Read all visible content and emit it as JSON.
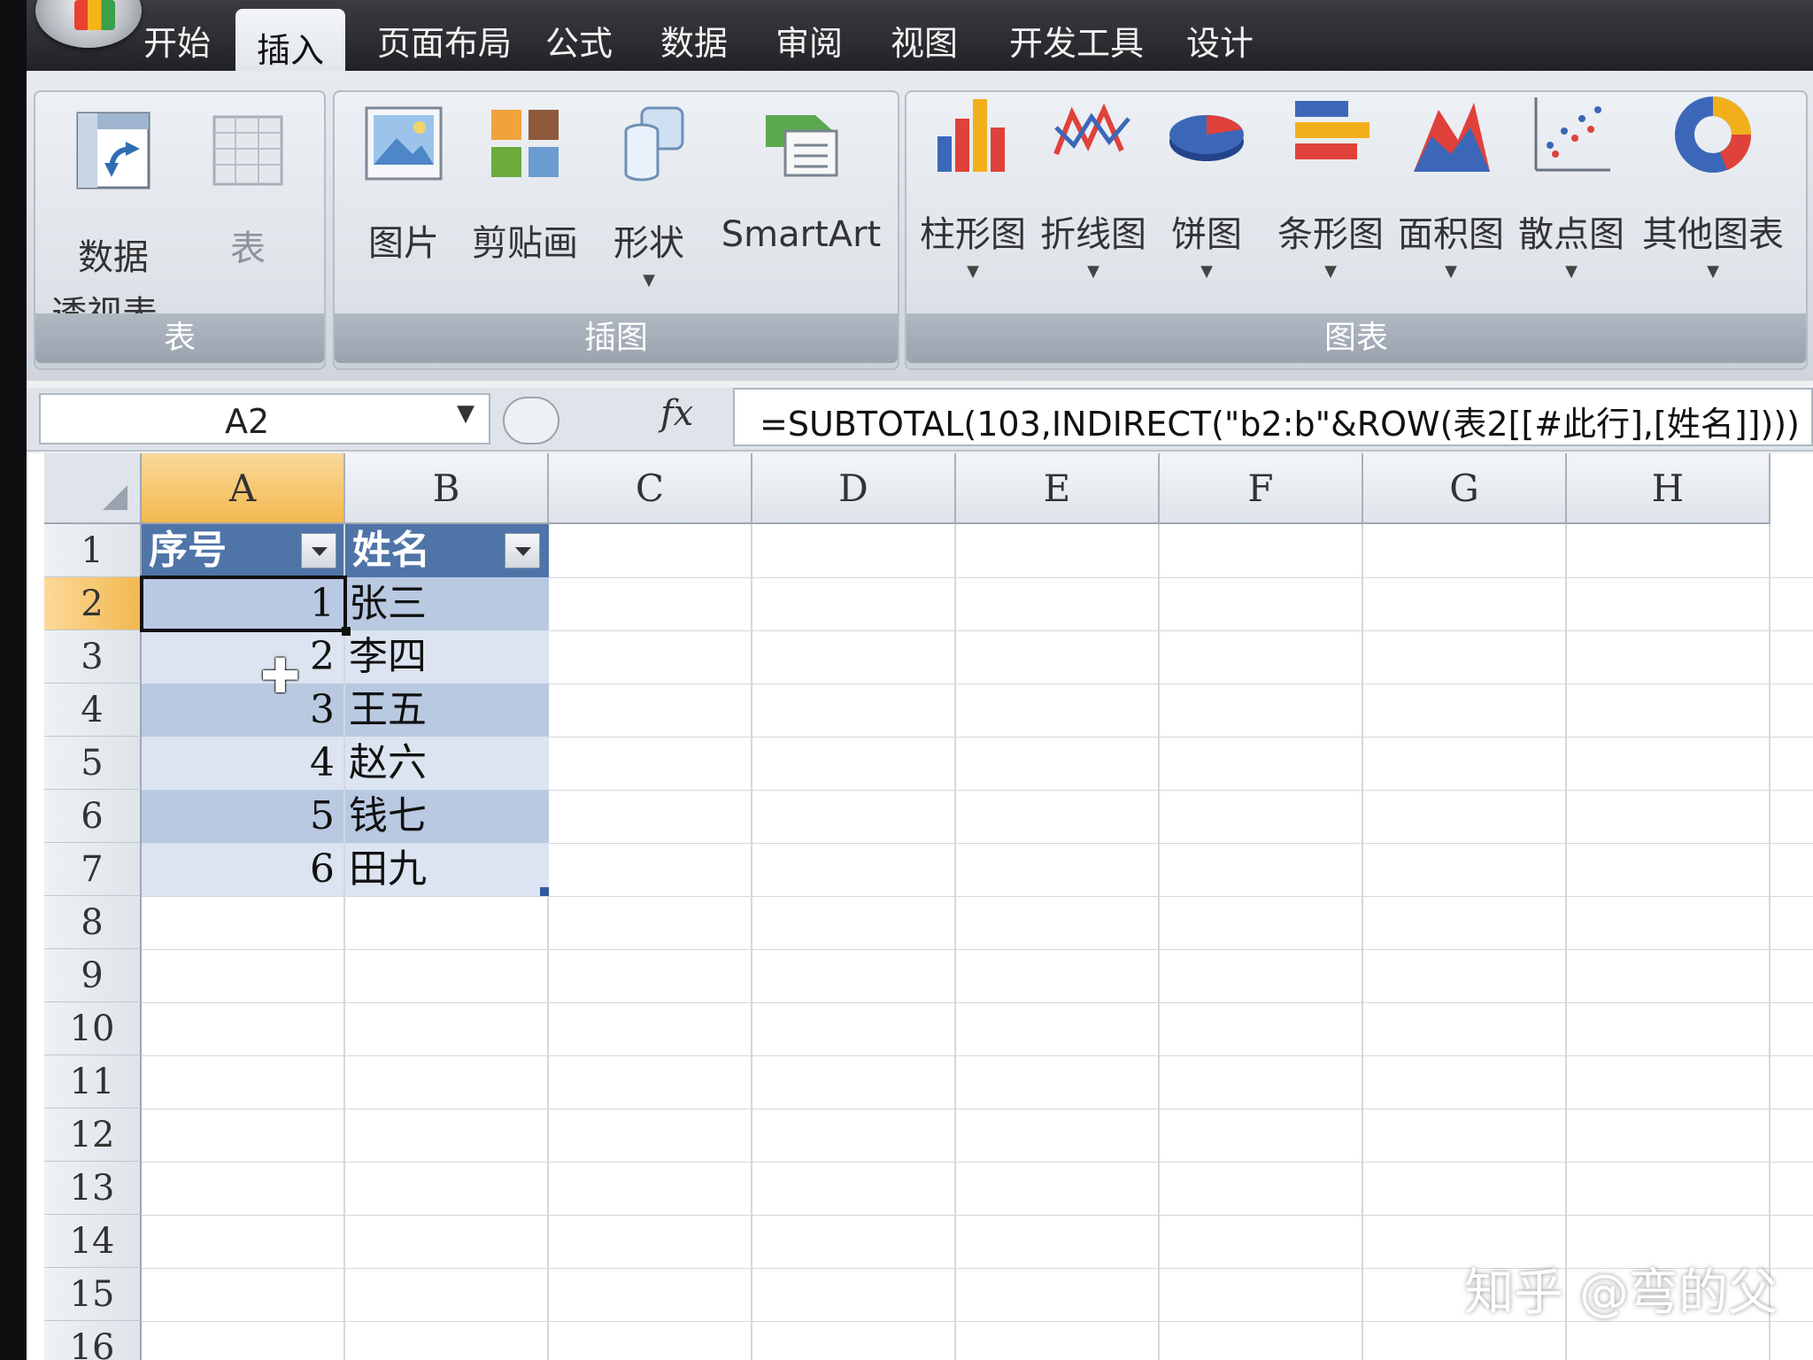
{
  "tabs": [
    "开始",
    "插入",
    "页面布局",
    "公式",
    "数据",
    "审阅",
    "视图",
    "开发工具",
    "设计"
  ],
  "active_tab": "插入",
  "ribbon": {
    "groups": {
      "table": {
        "label": "表",
        "pivot_line1": "数据",
        "pivot_line2": "透视表",
        "table_btn": "表"
      },
      "illustrations": {
        "label": "插图",
        "picture": "图片",
        "clipart": "剪贴画",
        "shapes": "形状",
        "smartart": "SmartArt"
      },
      "charts": {
        "label": "图表",
        "column": "柱形图",
        "line": "折线图",
        "pie": "饼图",
        "bar": "条形图",
        "area": "面积图",
        "scatter": "散点图",
        "other": "其他图表"
      }
    }
  },
  "formula_bar": {
    "name_box": "A2",
    "fx_label": "fx",
    "formula": "=SUBTOTAL(103,INDIRECT(\"b2:b\"&ROW(表2[[#此行],[姓名]])))"
  },
  "sheet": {
    "columns": [
      "A",
      "B",
      "C",
      "D",
      "E",
      "F",
      "G",
      "H"
    ],
    "rows": [
      "1",
      "2",
      "3",
      "4",
      "5",
      "6",
      "7",
      "8",
      "9",
      "10",
      "11",
      "12",
      "13",
      "14",
      "15",
      "16"
    ],
    "table_headers": {
      "a": "序号",
      "b": "姓名"
    },
    "table_rows": [
      {
        "num": "1",
        "name": "张三"
      },
      {
        "num": "2",
        "name": "李四"
      },
      {
        "num": "3",
        "name": "王五"
      },
      {
        "num": "4",
        "name": "赵六"
      },
      {
        "num": "5",
        "name": "钱七"
      },
      {
        "num": "6",
        "name": "田九"
      }
    ]
  },
  "watermark": "知乎 @弯的父"
}
